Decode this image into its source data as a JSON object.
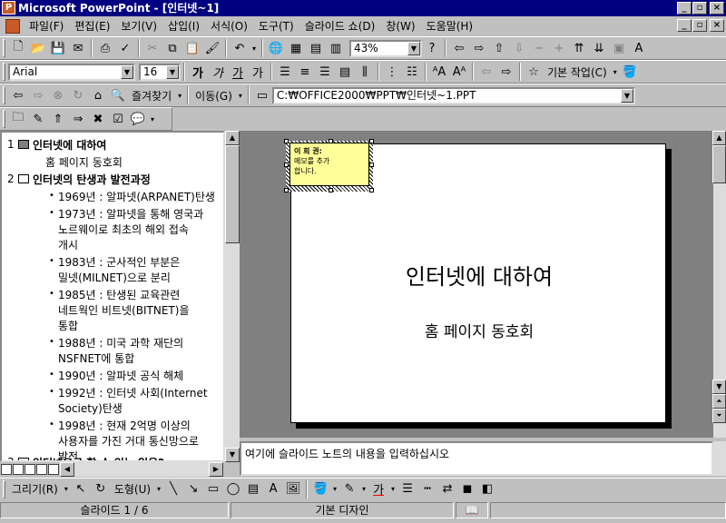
{
  "window": {
    "title": "Microsoft PowerPoint - [인터넷~1]",
    "app_icon": "powerpoint-icon"
  },
  "menu": [
    "파일(F)",
    "편집(E)",
    "보기(V)",
    "삽입(I)",
    "서식(O)",
    "도구(T)",
    "슬라이드 쇼(D)",
    "창(W)",
    "도움말(H)"
  ],
  "standard": {
    "zoom": "43%"
  },
  "formatting": {
    "font": "Arial",
    "size": "16",
    "bold": "가",
    "italic": "가",
    "underline": "가",
    "shadow": "가",
    "common_tasks": "기본 작업(C)"
  },
  "web": {
    "favorites": "즐겨찾기",
    "go": "이동(G)",
    "address": "C:₩OFFICE2000₩PPT₩인터넷~1.PPT"
  },
  "outline": {
    "slides": [
      {
        "num": "1",
        "title": "인터넷에 대하여",
        "sub": "홈 페이지 동호회"
      },
      {
        "num": "2",
        "title": "인터넷의 탄생과 발전과정"
      },
      {
        "num": "3",
        "title": "인터넷으로 할 수 있는 일은?"
      }
    ],
    "bullets": [
      [
        "1969년 : 알파넷(ARPANET)탄생"
      ],
      [
        "1973년 : 알파넷을 통해 영국과",
        "노르웨이로 최초의 해외 접속",
        "개시"
      ],
      [
        "1983년 : 군사적인 부분은",
        "밀넷(MILNET)으로 분리"
      ],
      [
        "1985년 : 탄생된 교육관련",
        "네트웍인 비트넷(BITNET)을",
        "통합"
      ],
      [
        "1988년 : 미국 과학 재단의",
        "NSFNET에 통합"
      ],
      [
        "1990년 : 알파넷 공식 해체"
      ],
      [
        "1992년 : 인터넷 사회(Internet",
        "Society)탄생"
      ],
      [
        "1998년 : 현재 2억명 이상의",
        "사용자를 가진 거대 통신망으로",
        "발전"
      ]
    ]
  },
  "slide": {
    "title": "인터넷에 대하여",
    "subtitle": "홈 페이지 동호회",
    "comment_author": "이 희 권:",
    "comment_text": "메모를 추가합니다."
  },
  "notes": {
    "placeholder": "여기에 슬라이드 노트의 내용을 입력하십시오"
  },
  "drawing": {
    "draw": "그리기(R)",
    "autoshapes": "도형(U)"
  },
  "status": {
    "slide": "슬라이드 1 / 6",
    "design": "기본 디자인"
  }
}
